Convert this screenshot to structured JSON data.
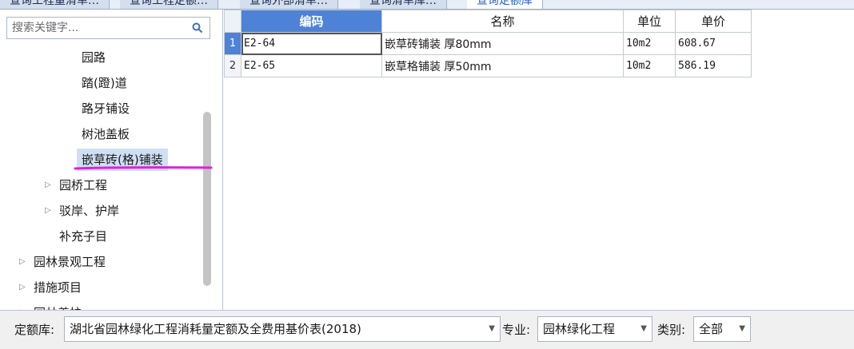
{
  "tabs": [
    {
      "label": "查询工程量清单…"
    },
    {
      "label": "查询工程定额…"
    },
    {
      "label": "查询外部清单…"
    },
    {
      "label": "查询清单库…"
    },
    {
      "label": "查询定额库",
      "active": true
    }
  ],
  "search": {
    "placeholder": "搜索关键字..."
  },
  "tree": [
    {
      "label": "园路",
      "level": 2
    },
    {
      "label": "踏(蹬)道",
      "level": 2
    },
    {
      "label": "路牙铺设",
      "level": 2
    },
    {
      "label": "树池盖板",
      "level": 2
    },
    {
      "label": "嵌草砖(格)铺装",
      "level": 2,
      "selected": true
    },
    {
      "label": "园桥工程",
      "level": 1,
      "collapsed": true
    },
    {
      "label": "驳岸、护岸",
      "level": 1,
      "collapsed": true
    },
    {
      "label": "补充子目",
      "level": 1
    },
    {
      "label": "园林景观工程",
      "level": 0,
      "collapsed": true
    },
    {
      "label": "措施项目",
      "level": 0,
      "collapsed": true
    },
    {
      "label": "园林养护",
      "level": 0,
      "collapsed": true
    }
  ],
  "grid": {
    "columns": [
      "编码",
      "名称",
      "单位",
      "单价"
    ],
    "rows": [
      {
        "no": "1",
        "code": "E2-64",
        "name": "嵌草砖铺装 厚80mm",
        "unit": "10m2",
        "price": "608.67"
      },
      {
        "no": "2",
        "code": "E2-65",
        "name": "嵌草格铺装 厚50mm",
        "unit": "10m2",
        "price": "586.19"
      }
    ]
  },
  "footer": {
    "quota_label": "定额库:",
    "quota_value": "湖北省园林绿化工程消耗量定额及全费用基价表(2018)",
    "major_label": "专业:",
    "major_value": "园林绿化工程",
    "category_label": "类别:",
    "category_value": "全部"
  },
  "colors": {
    "accent": "#4d82d6",
    "selection": "#cfe0f5",
    "highlight_underline": "#e020e0"
  },
  "icons": {
    "search": "magnifier-icon",
    "expand": "triangle-right-icon",
    "dropdown": "chevron-down-icon"
  }
}
